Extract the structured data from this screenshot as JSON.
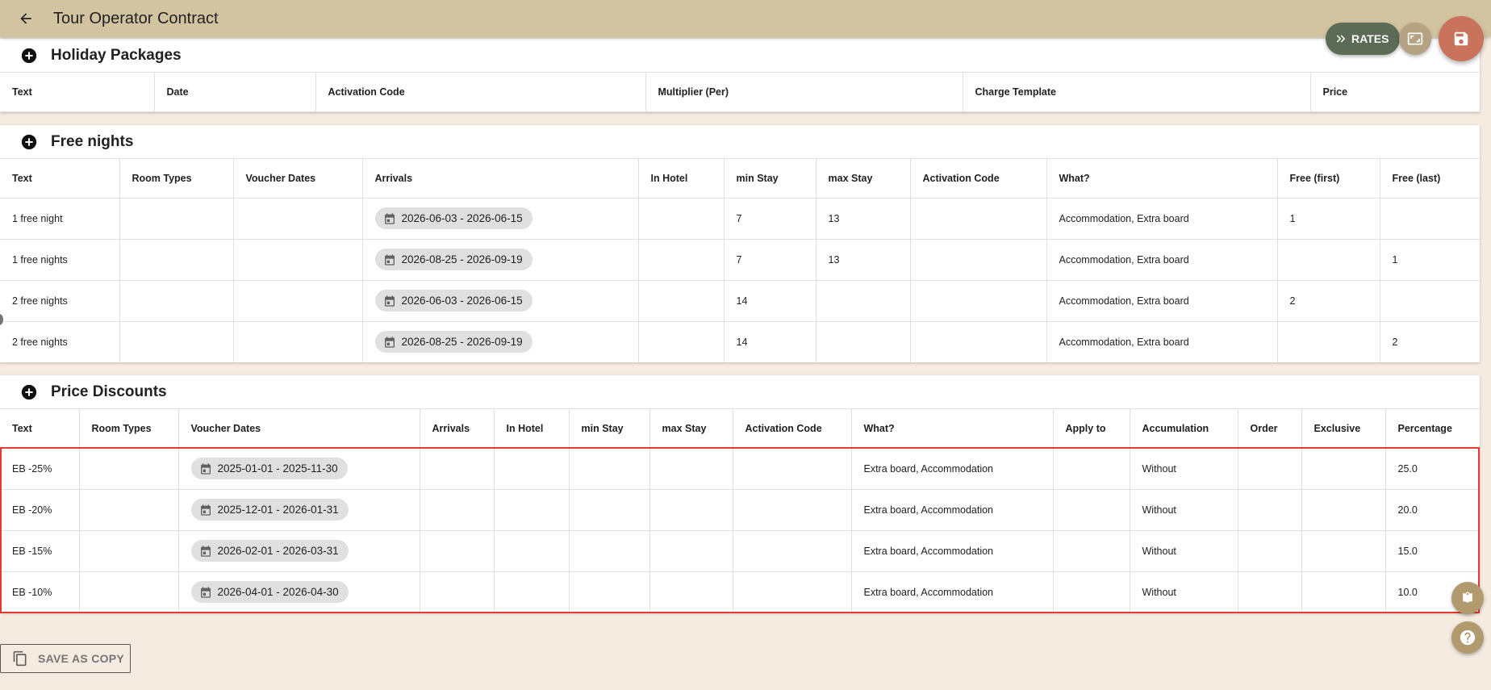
{
  "header": {
    "title": "Tour Operator Contract"
  },
  "actions": {
    "rates_label": "RATES",
    "save_as_copy_label": "SAVE AS COPY"
  },
  "holiday_packages": {
    "title": "Holiday Packages",
    "columns": [
      "Text",
      "Date",
      "Activation Code",
      "Multiplier (Per)",
      "Charge Template",
      "Price"
    ]
  },
  "free_nights": {
    "title": "Free nights",
    "columns": [
      "Text",
      "Room Types",
      "Voucher Dates",
      "Arrivals",
      "In Hotel",
      "min Stay",
      "max Stay",
      "Activation Code",
      "What?",
      "Free (first)",
      "Free (last)"
    ],
    "rows": [
      {
        "text": "1 free night",
        "room_types": "",
        "voucher_dates": "",
        "arrivals": "2026-06-03 - 2026-06-15",
        "in_hotel": "",
        "min_stay": "7",
        "max_stay": "13",
        "activation_code": "",
        "what": "Accommodation, Extra board",
        "free_first": "1",
        "free_last": ""
      },
      {
        "text": "1 free nights",
        "room_types": "",
        "voucher_dates": "",
        "arrivals": "2026-08-25 - 2026-09-19",
        "in_hotel": "",
        "min_stay": "7",
        "max_stay": "13",
        "activation_code": "",
        "what": "Accommodation, Extra board",
        "free_first": "",
        "free_last": "1"
      },
      {
        "text": "2 free nights",
        "room_types": "",
        "voucher_dates": "",
        "arrivals": "2026-06-03 - 2026-06-15",
        "in_hotel": "",
        "min_stay": "14",
        "max_stay": "",
        "activation_code": "",
        "what": "Accommodation, Extra board",
        "free_first": "2",
        "free_last": ""
      },
      {
        "text": "2 free nights",
        "room_types": "",
        "voucher_dates": "",
        "arrivals": "2026-08-25 - 2026-09-19",
        "in_hotel": "",
        "min_stay": "14",
        "max_stay": "",
        "activation_code": "",
        "what": "Accommodation, Extra board",
        "free_first": "",
        "free_last": "2"
      }
    ]
  },
  "price_discounts": {
    "title": "Price Discounts",
    "columns": [
      "Text",
      "Room Types",
      "Voucher Dates",
      "Arrivals",
      "In Hotel",
      "min Stay",
      "max Stay",
      "Activation Code",
      "What?",
      "Apply to",
      "Accumulation",
      "Order",
      "Exclusive",
      "Percentage"
    ],
    "rows": [
      {
        "text": "EB -25%",
        "room_types": "",
        "voucher_dates": "2025-01-01 - 2025-11-30",
        "arrivals": "",
        "in_hotel": "",
        "min_stay": "",
        "max_stay": "",
        "activation_code": "",
        "what": "Extra board, Accommodation",
        "apply_to": "",
        "accumulation": "Without",
        "order": "",
        "exclusive": "",
        "percentage": "25.0"
      },
      {
        "text": "EB -20%",
        "room_types": "",
        "voucher_dates": "2025-12-01 - 2026-01-31",
        "arrivals": "",
        "in_hotel": "",
        "min_stay": "",
        "max_stay": "",
        "activation_code": "",
        "what": "Extra board, Accommodation",
        "apply_to": "",
        "accumulation": "Without",
        "order": "",
        "exclusive": "",
        "percentage": "20.0"
      },
      {
        "text": "EB -15%",
        "room_types": "",
        "voucher_dates": "2026-02-01 - 2026-03-31",
        "arrivals": "",
        "in_hotel": "",
        "min_stay": "",
        "max_stay": "",
        "activation_code": "",
        "what": "Extra board, Accommodation",
        "apply_to": "",
        "accumulation": "Without",
        "order": "",
        "exclusive": "",
        "percentage": "15.0"
      },
      {
        "text": "EB -10%",
        "room_types": "",
        "voucher_dates": "2026-04-01 - 2026-04-30",
        "arrivals": "",
        "in_hotel": "",
        "min_stay": "",
        "max_stay": "",
        "activation_code": "",
        "what": "Extra board, Accommodation",
        "apply_to": "",
        "accumulation": "Without",
        "order": "",
        "exclusive": "",
        "percentage": "10.0"
      }
    ]
  },
  "icons": {
    "back": "arrow-left-icon",
    "add": "add-circle-icon",
    "calendar": "calendar-icon",
    "rates": "double-chevron-right-icon",
    "fullscreen": "fullscreen-icon",
    "save": "save-icon",
    "copy": "copy-icon",
    "book": "book-icon",
    "help": "help-icon"
  },
  "colors": {
    "topbar": "#d2c4a0",
    "background": "#f5ebe1",
    "rates_button": "#5b6b55",
    "save_button": "#c9735c",
    "highlight_border": "#e53935"
  }
}
